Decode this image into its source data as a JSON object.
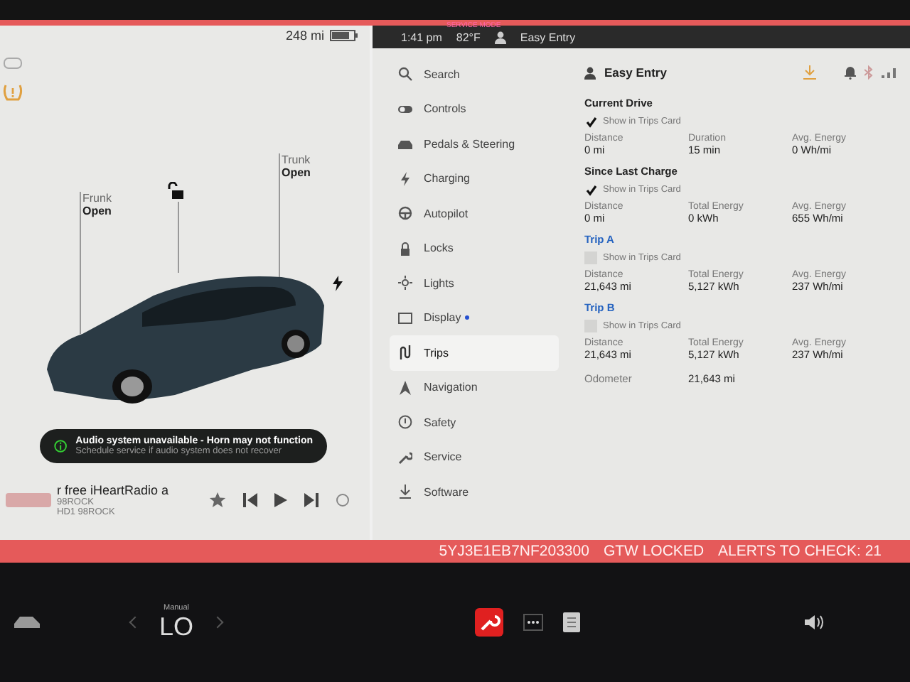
{
  "status_bar": {
    "service_mode": "SERVICE MODE",
    "range": "248 mi",
    "time": "1:41 pm",
    "temperature": "82°F",
    "profile": "Easy Entry"
  },
  "car_view": {
    "frunk": {
      "label": "Frunk",
      "state": "Open"
    },
    "trunk": {
      "label": "Trunk",
      "state": "Open"
    },
    "locked": false
  },
  "alert": {
    "title": "Audio system unavailable - Horn may not function",
    "subtitle": "Schedule service if audio system does not recover"
  },
  "media": {
    "title": "r free iHeartRadio a",
    "station": "98ROCK",
    "subtitle": "HD1 98ROCK"
  },
  "menu": [
    {
      "label": "Search",
      "kind": "search",
      "selected": false,
      "badge": false
    },
    {
      "label": "Controls",
      "kind": "toggle",
      "selected": false,
      "badge": false
    },
    {
      "label": "Pedals & Steering",
      "kind": "car",
      "selected": false,
      "badge": false
    },
    {
      "label": "Charging",
      "kind": "bolt",
      "selected": false,
      "badge": false
    },
    {
      "label": "Autopilot",
      "kind": "wheel",
      "selected": false,
      "badge": false
    },
    {
      "label": "Locks",
      "kind": "lock",
      "selected": false,
      "badge": false
    },
    {
      "label": "Lights",
      "kind": "sun",
      "selected": false,
      "badge": false
    },
    {
      "label": "Display",
      "kind": "display",
      "selected": false,
      "badge": true
    },
    {
      "label": "Trips",
      "kind": "trips",
      "selected": true,
      "badge": false
    },
    {
      "label": "Navigation",
      "kind": "nav",
      "selected": false,
      "badge": false
    },
    {
      "label": "Safety",
      "kind": "safety",
      "selected": false,
      "badge": false
    },
    {
      "label": "Service",
      "kind": "wrench",
      "selected": false,
      "badge": false
    },
    {
      "label": "Software",
      "kind": "download",
      "selected": false,
      "badge": false
    }
  ],
  "profile_header": "Easy Entry",
  "sections": [
    {
      "kind": "drive",
      "title": "Current Drive",
      "checkbox": {
        "label": "Show in Trips Card",
        "checked": true
      },
      "stats": [
        {
          "label": "Distance",
          "value": "0 mi"
        },
        {
          "label": "Duration",
          "value": "15 min"
        },
        {
          "label": "Avg. Energy",
          "value": "0 Wh/mi"
        }
      ]
    },
    {
      "kind": "drive",
      "title": "Since Last Charge",
      "checkbox": {
        "label": "Show in Trips Card",
        "checked": true
      },
      "stats": [
        {
          "label": "Distance",
          "value": "0 mi"
        },
        {
          "label": "Total Energy",
          "value": "0 kWh"
        },
        {
          "label": "Avg. Energy",
          "value": "655 Wh/mi"
        }
      ]
    },
    {
      "kind": "trip",
      "title": "Trip A",
      "checkbox": {
        "label": "Show in Trips Card",
        "checked": false
      },
      "stats": [
        {
          "label": "Distance",
          "value": "21,643 mi"
        },
        {
          "label": "Total Energy",
          "value": "5,127 kWh"
        },
        {
          "label": "Avg. Energy",
          "value": "237 Wh/mi"
        }
      ]
    },
    {
      "kind": "trip",
      "title": "Trip B",
      "checkbox": {
        "label": "Show in Trips Card",
        "checked": false
      },
      "stats": [
        {
          "label": "Distance",
          "value": "21,643 mi"
        },
        {
          "label": "Total Energy",
          "value": "5,127 kWh"
        },
        {
          "label": "Avg. Energy",
          "value": "237 Wh/mi"
        }
      ]
    }
  ],
  "odometer": {
    "label": "Odometer",
    "value": "21,643 mi"
  },
  "service_bar": {
    "vin": "5YJ3E1EB7NF203300",
    "gtw": "GTW LOCKED",
    "alerts": "ALERTS TO CHECK: 21"
  },
  "climate": {
    "mode": "Manual",
    "temperature": "LO"
  }
}
